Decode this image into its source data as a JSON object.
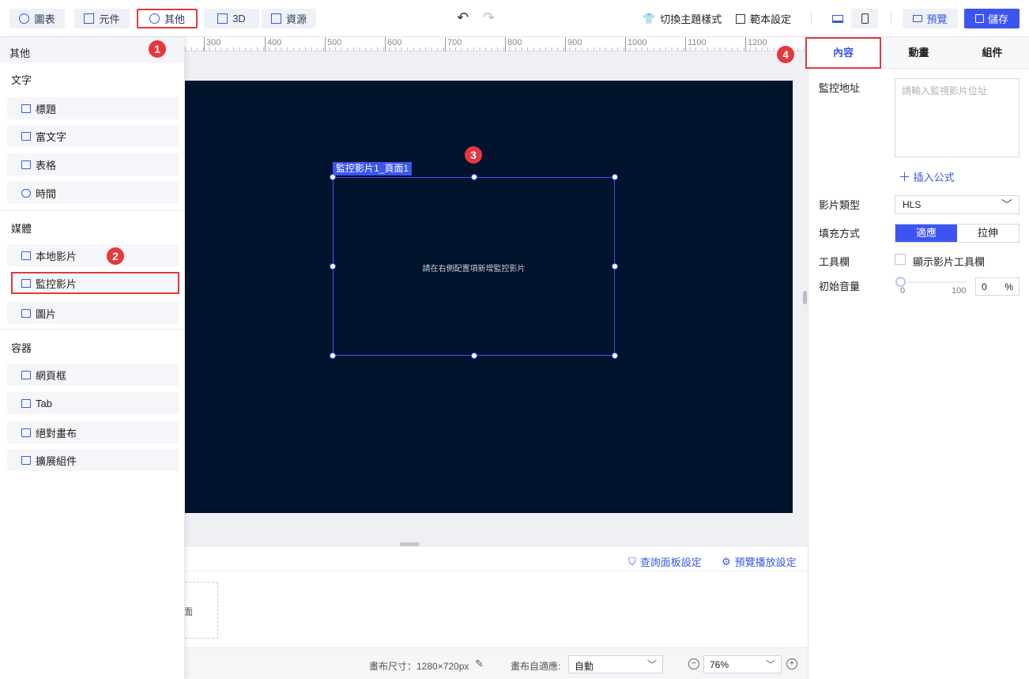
{
  "toolbar": {
    "tabs": [
      {
        "label": "圖表",
        "icon": "chart-icon"
      },
      {
        "label": "元件",
        "icon": "component-icon"
      },
      {
        "label": "其他",
        "icon": "more-icon"
      },
      {
        "label": "3D",
        "icon": "cube-icon"
      },
      {
        "label": "資源",
        "icon": "archive-icon"
      }
    ],
    "theme_label": "切換主題樣式",
    "template_label": "範本設定",
    "preview_label": "預覽",
    "save_label": "儲存"
  },
  "left_panel": {
    "title": "其他",
    "sections": [
      {
        "title": "文字",
        "items": [
          "標題",
          "富文字",
          "表格",
          "時間"
        ]
      },
      {
        "title": "媒體",
        "items": [
          "本地影片",
          "監控影片",
          "圖片"
        ]
      },
      {
        "title": "容器",
        "items": [
          "網頁框",
          "Tab",
          "絕對畫布",
          "擴展組件"
        ]
      }
    ],
    "selected_item": "監控影片"
  },
  "badges": [
    "1",
    "2",
    "3",
    "4"
  ],
  "ruler": {
    "ticks": [
      "300",
      "400",
      "500",
      "600",
      "700",
      "800",
      "900",
      "1000",
      "1100",
      "1200"
    ]
  },
  "canvas": {
    "selected_tag": "監控影片1_頁面1",
    "hint": "請在右側配置項新增監控影片"
  },
  "bottom": {
    "query_panel_label": "查詢面板設定",
    "playback_label": "預覽播放設定",
    "page_thumb_label": "面"
  },
  "status": {
    "canvas_size": "畫布尺寸：1280×720px",
    "adapt_label": "畫布自適應:",
    "adapt_value": "自動",
    "zoom": "76%"
  },
  "right_panel": {
    "tabs": [
      "內容",
      "動畫",
      "組件"
    ],
    "fields": {
      "url_label": "監控地址",
      "url_placeholder": "請輸入監視影片位址",
      "insert_formula": "插入公式",
      "type_label": "影片類型",
      "type_value": "HLS",
      "fill_label": "填充方式",
      "fill_options": [
        "適應",
        "拉伸"
      ],
      "toolbar_label": "工具欄",
      "toolbar_checkbox": "顯示影片工具欄",
      "volume_label": "初始音量",
      "volume_min": "0",
      "volume_max": "100",
      "volume_value": "0",
      "volume_unit": "%"
    }
  },
  "colors": {
    "accent": "#3d55f0",
    "highlight": "#e0393e",
    "artboard": "#00132c"
  }
}
